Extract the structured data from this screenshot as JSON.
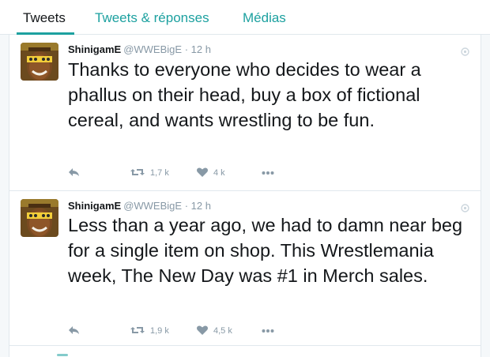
{
  "tabs": [
    {
      "label": "Tweets"
    },
    {
      "label": "Tweets & réponses"
    },
    {
      "label": "Médias"
    }
  ],
  "tweets": [
    {
      "name": "ShinigamE",
      "handle": "@WWEBigE",
      "dot": "·",
      "time": "12 h",
      "text": "Thanks to everyone who decides to wear a phallus on their head, buy a box of fictional cereal, and wants wrestling to be fun.",
      "retweets": "1,7 k",
      "likes": "4 k"
    },
    {
      "name": "ShinigamE",
      "handle": "@WWEBigE",
      "dot": "·",
      "time": "12 h",
      "text": "Less than a year ago, we had to damn near beg for a single item on shop. This Wrestlemania week, The New Day was #1 in Merch sales.",
      "retweets": "1,9 k",
      "likes": "4,5 k"
    }
  ],
  "icons": {
    "reply": "reply-icon",
    "retweet": "retweet-icon",
    "like": "heart-icon",
    "more": "more-icon",
    "caret": "caret-icon"
  },
  "colors": {
    "accent": "#1da1a0",
    "muted": "#8899a6",
    "text": "#14171a",
    "border": "#e1e8ed"
  }
}
